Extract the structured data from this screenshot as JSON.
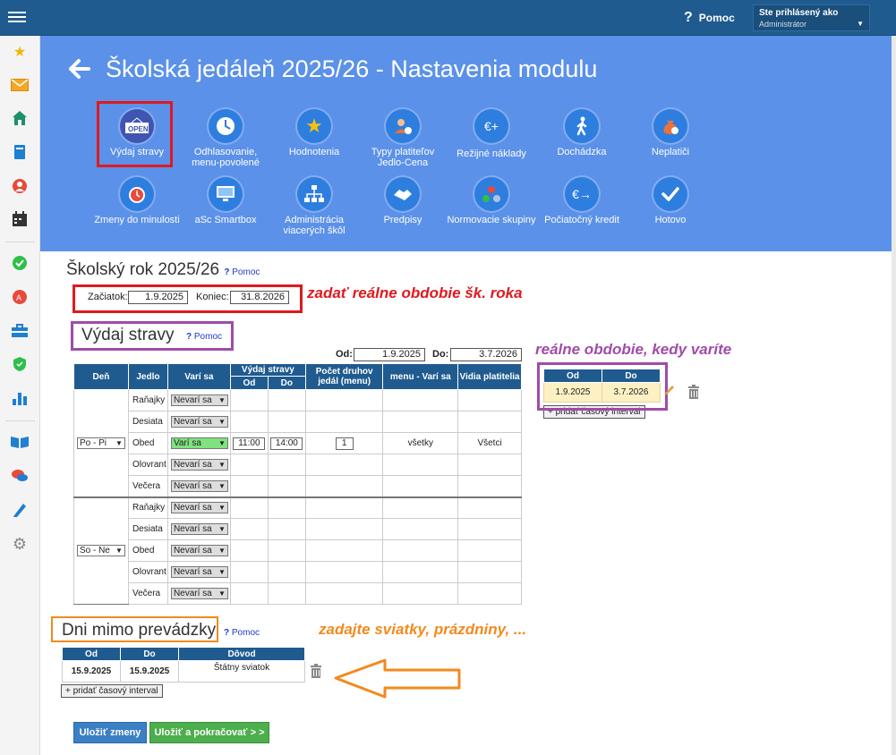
{
  "topbar": {
    "help_label": "Pomoc",
    "user_line1": "Ste prihlásený ako",
    "user_line2": "Administrátor"
  },
  "header": {
    "title": "Školská jedáleň 2025/26 - Nastavenia modulu",
    "modules": [
      {
        "label": "Výdaj stravy",
        "icon": "open-sign-icon"
      },
      {
        "label": "Odhlasovanie, menu-povolené",
        "icon": "clock-icon"
      },
      {
        "label": "Hodnotenia",
        "icon": "star-icon"
      },
      {
        "label": "Typy platiteľov Jedlo-Cena",
        "icon": "person-coin-icon"
      },
      {
        "label": "Režijné náklady",
        "icon": "euro-plus-icon"
      },
      {
        "label": "Dochádzka",
        "icon": "walking-person-icon"
      },
      {
        "label": "Neplatiči",
        "icon": "money-bag-icon"
      },
      {
        "label": "Zmeny do minulosti",
        "icon": "alarm-clock-icon"
      },
      {
        "label": "aSc Smartbox",
        "icon": "monitor-icon"
      },
      {
        "label": "Administrácia viacerých škôl",
        "icon": "org-chart-icon"
      },
      {
        "label": "Predpisy",
        "icon": "handshake-icon"
      },
      {
        "label": "Normovacie skupiny",
        "icon": "three-dots-icon"
      },
      {
        "label": "Počiatočný kredit",
        "icon": "euro-arrow-icon"
      },
      {
        "label": "Hotovo",
        "icon": "checkmark-icon"
      }
    ]
  },
  "school_year": {
    "title": "Školský rok 2025/26",
    "help": "Pomoc",
    "start_label": "Začiatok:",
    "start_value": "1.9.2025",
    "end_label": "Koniec:",
    "end_value": "31.8.2026",
    "note": "zadať reálne obdobie šk. roka"
  },
  "vydaj": {
    "title": "Výdaj stravy",
    "help": "Pomoc",
    "from_label": "Od:",
    "from_value": "1.9.2025",
    "to_label": "Do:",
    "to_value": "3.7.2026",
    "headers": {
      "den": "Deň",
      "jedlo": "Jedlo",
      "vari": "Varí sa",
      "vydaj": "Výdaj stravy",
      "od": "Od",
      "do": "Do",
      "pocet": "Počet druhov jedál (menu)",
      "menu": "menu - Varí sa",
      "vidia": "Vidia platitelia"
    },
    "groups": [
      {
        "day": "Po - Pi",
        "rows": [
          {
            "meal": "Raňajky",
            "status": "Nevarí sa",
            "od": "",
            "do": "",
            "count": "",
            "menu": "",
            "payers": ""
          },
          {
            "meal": "Desiata",
            "status": "Nevarí sa",
            "od": "",
            "do": "",
            "count": "",
            "menu": "",
            "payers": ""
          },
          {
            "meal": "Obed",
            "status": "Varí sa",
            "od": "11:00",
            "do": "14:00",
            "count": "1",
            "menu": "všetky",
            "payers": "Všetci"
          },
          {
            "meal": "Olovrant",
            "status": "Nevarí sa",
            "od": "",
            "do": "",
            "count": "",
            "menu": "",
            "payers": ""
          },
          {
            "meal": "Večera",
            "status": "Nevarí sa",
            "od": "",
            "do": "",
            "count": "",
            "menu": "",
            "payers": ""
          }
        ]
      },
      {
        "day": "So - Ne",
        "rows": [
          {
            "meal": "Raňajky",
            "status": "Nevarí sa",
            "od": "",
            "do": "",
            "count": "",
            "menu": "",
            "payers": ""
          },
          {
            "meal": "Desiata",
            "status": "Nevarí sa",
            "od": "",
            "do": "",
            "count": "",
            "menu": "",
            "payers": ""
          },
          {
            "meal": "Obed",
            "status": "Nevarí sa",
            "od": "",
            "do": "",
            "count": "",
            "menu": "",
            "payers": ""
          },
          {
            "meal": "Olovrant",
            "status": "Nevarí sa",
            "od": "",
            "do": "",
            "count": "",
            "menu": "",
            "payers": ""
          },
          {
            "meal": "Večera",
            "status": "Nevarí sa",
            "od": "",
            "do": "",
            "count": "",
            "menu": "",
            "payers": ""
          }
        ]
      }
    ],
    "periods_note": "reálne obdobie, kedy varíte",
    "periods_headers": {
      "od": "Od",
      "do": "Do"
    },
    "periods": [
      {
        "od": "1.9.2025",
        "do": "3.7.2026"
      }
    ],
    "add_interval": "+ pridať časový interval"
  },
  "closed_days": {
    "title": "Dni mimo prevádzky",
    "help": "Pomoc",
    "note": "zadajte sviatky, prázdniny, ...",
    "headers": {
      "od": "Od",
      "do": "Do",
      "dovod": "Dôvod"
    },
    "rows": [
      {
        "od": "15.9.2025",
        "do": "15.9.2025",
        "dovod": "Štátny sviatok"
      }
    ],
    "add_interval": "+ pridať časový interval"
  },
  "buttons": {
    "save": "Uložiť zmeny",
    "save_continue": "Uložiť a pokračovať > >"
  },
  "colors": {
    "topbar": "#1f5b8f",
    "header": "#5b91e8",
    "table_header": "#1f5b8f",
    "period_row": "#fdf1c4",
    "note_red": "#e0191f",
    "note_purple": "#a14ba8",
    "note_orange": "#f28a1e",
    "save_button": "#3b7fc4",
    "continue_button": "#4cae4c"
  }
}
